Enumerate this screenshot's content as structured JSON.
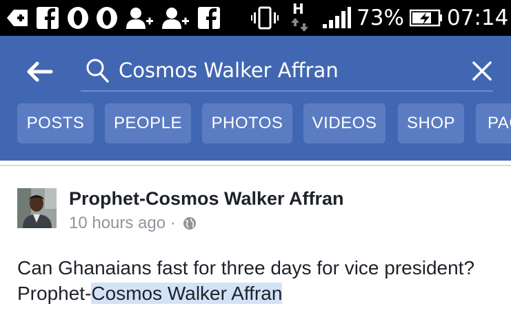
{
  "status_bar": {
    "battery": "73%",
    "time": "07:14",
    "network": "H"
  },
  "search": {
    "query": "Cosmos Walker Affran"
  },
  "filters": [
    {
      "label": "POSTS"
    },
    {
      "label": "PEOPLE"
    },
    {
      "label": "PHOTOS"
    },
    {
      "label": "VIDEOS"
    },
    {
      "label": "SHOP"
    },
    {
      "label": "PAGES"
    }
  ],
  "post": {
    "author": "Prophet-Cosmos Walker Affran",
    "time": "10 hours ago",
    "separator": "·",
    "text_line1": "Can Ghanaians fast for three days for vice president?",
    "text_line2_prefix": "Prophet-",
    "text_line2_highlight": "Cosmos Walker Affran"
  },
  "colors": {
    "header": "#4267b2",
    "chip": "#5b7cc3",
    "highlight": "#d4e2f8"
  }
}
